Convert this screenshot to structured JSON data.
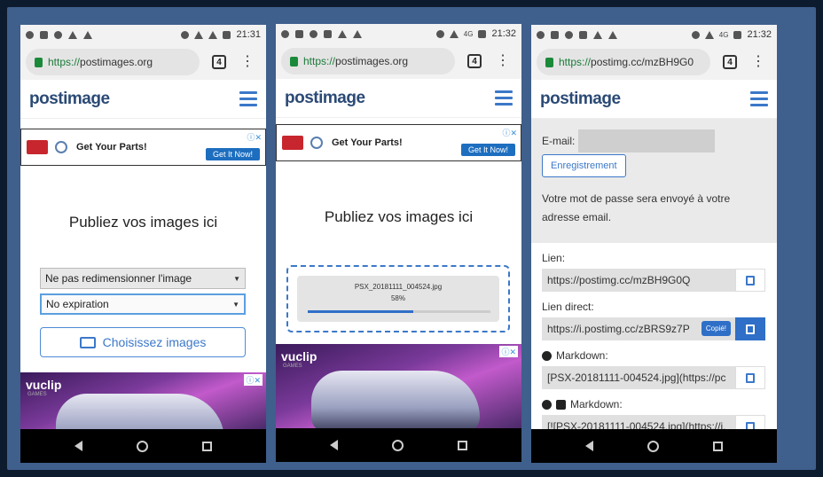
{
  "status_bar": {
    "time1": "21:31",
    "time2": "21:32",
    "time3": "21:32",
    "network": "4G"
  },
  "browser": {
    "url1": {
      "scheme": "https://",
      "host": "postimages.org"
    },
    "url2": {
      "scheme": "https://",
      "host": "postimages.org"
    },
    "url3": {
      "scheme": "https://",
      "host": "postimg.cc/mzBH9G0"
    },
    "tab_count": "4"
  },
  "site": {
    "logo_main": "post",
    "logo_rest": "image"
  },
  "ad": {
    "text": "Get Your Parts!",
    "button": "Get It Now!",
    "close": "ⓘ✕"
  },
  "upload": {
    "heading": "Publiez vos images ici",
    "resize_option": "Ne pas redimensionner l'image",
    "expiration_option": "No expiration",
    "choose_button": "Choisissez images",
    "file_name": "PSX_20181111_004524.jpg",
    "progress_label": "58%",
    "progress_value": 0.58
  },
  "video_ad": {
    "brand": "vuclip",
    "sub": "GAMES",
    "close": "ⓘ✕"
  },
  "result": {
    "email_label": "E-mail:",
    "register_button": "Enregistrement",
    "note": "Votre mot de passe sera envoyé à votre adresse email.",
    "link_label": "Lien:",
    "link_value": "https://postimg.cc/mzBH9G0Q",
    "direct_label": "Lien direct:",
    "direct_value": "https://i.postimg.cc/zBRS9z7P",
    "copied_tooltip": "Copié!",
    "markdown_label1": "Markdown:",
    "markdown_value1": "[PSX-20181111-004524.jpg](https://pc",
    "markdown_label2": "Markdown:",
    "markdown_value2": "[![PSX-20181111-004524.jpg](https://i."
  },
  "colors": {
    "accent": "#3b78c9",
    "frame": "#3f5f8c",
    "secure": "#1a7a38"
  }
}
